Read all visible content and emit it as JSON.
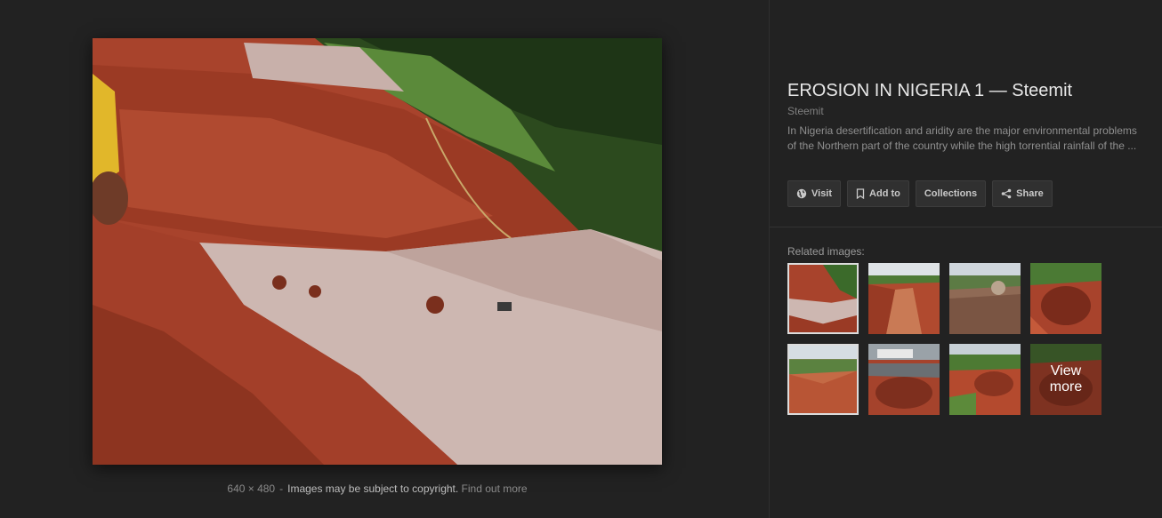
{
  "image": {
    "dimensions": "640 × 480",
    "copyright_notice": "Images may be subject to copyright.",
    "find_out_more": "Find out more",
    "separator": "-"
  },
  "details": {
    "title": "EROSION IN NIGERIA 1 — Steemit",
    "source": "Steemit",
    "description": "In Nigeria desertification and aridity are the major environmental problems of the Northern part of the country while the high torrential rainfall of the ..."
  },
  "actions": [
    {
      "label": "Visit",
      "icon": "globe-icon"
    },
    {
      "label": "Add to",
      "icon": "bookmark-icon"
    },
    {
      "label": "Collections",
      "icon": ""
    },
    {
      "label": "Share",
      "icon": "share-icon"
    }
  ],
  "related": {
    "label": "Related images:",
    "view_more_line1": "View",
    "view_more_line2": "more"
  },
  "colors": {
    "background": "#222222",
    "button_bg": "#303030",
    "soil": "#b4452d",
    "road": "#c9b3ad",
    "vegetation": "#3f6b2e"
  }
}
